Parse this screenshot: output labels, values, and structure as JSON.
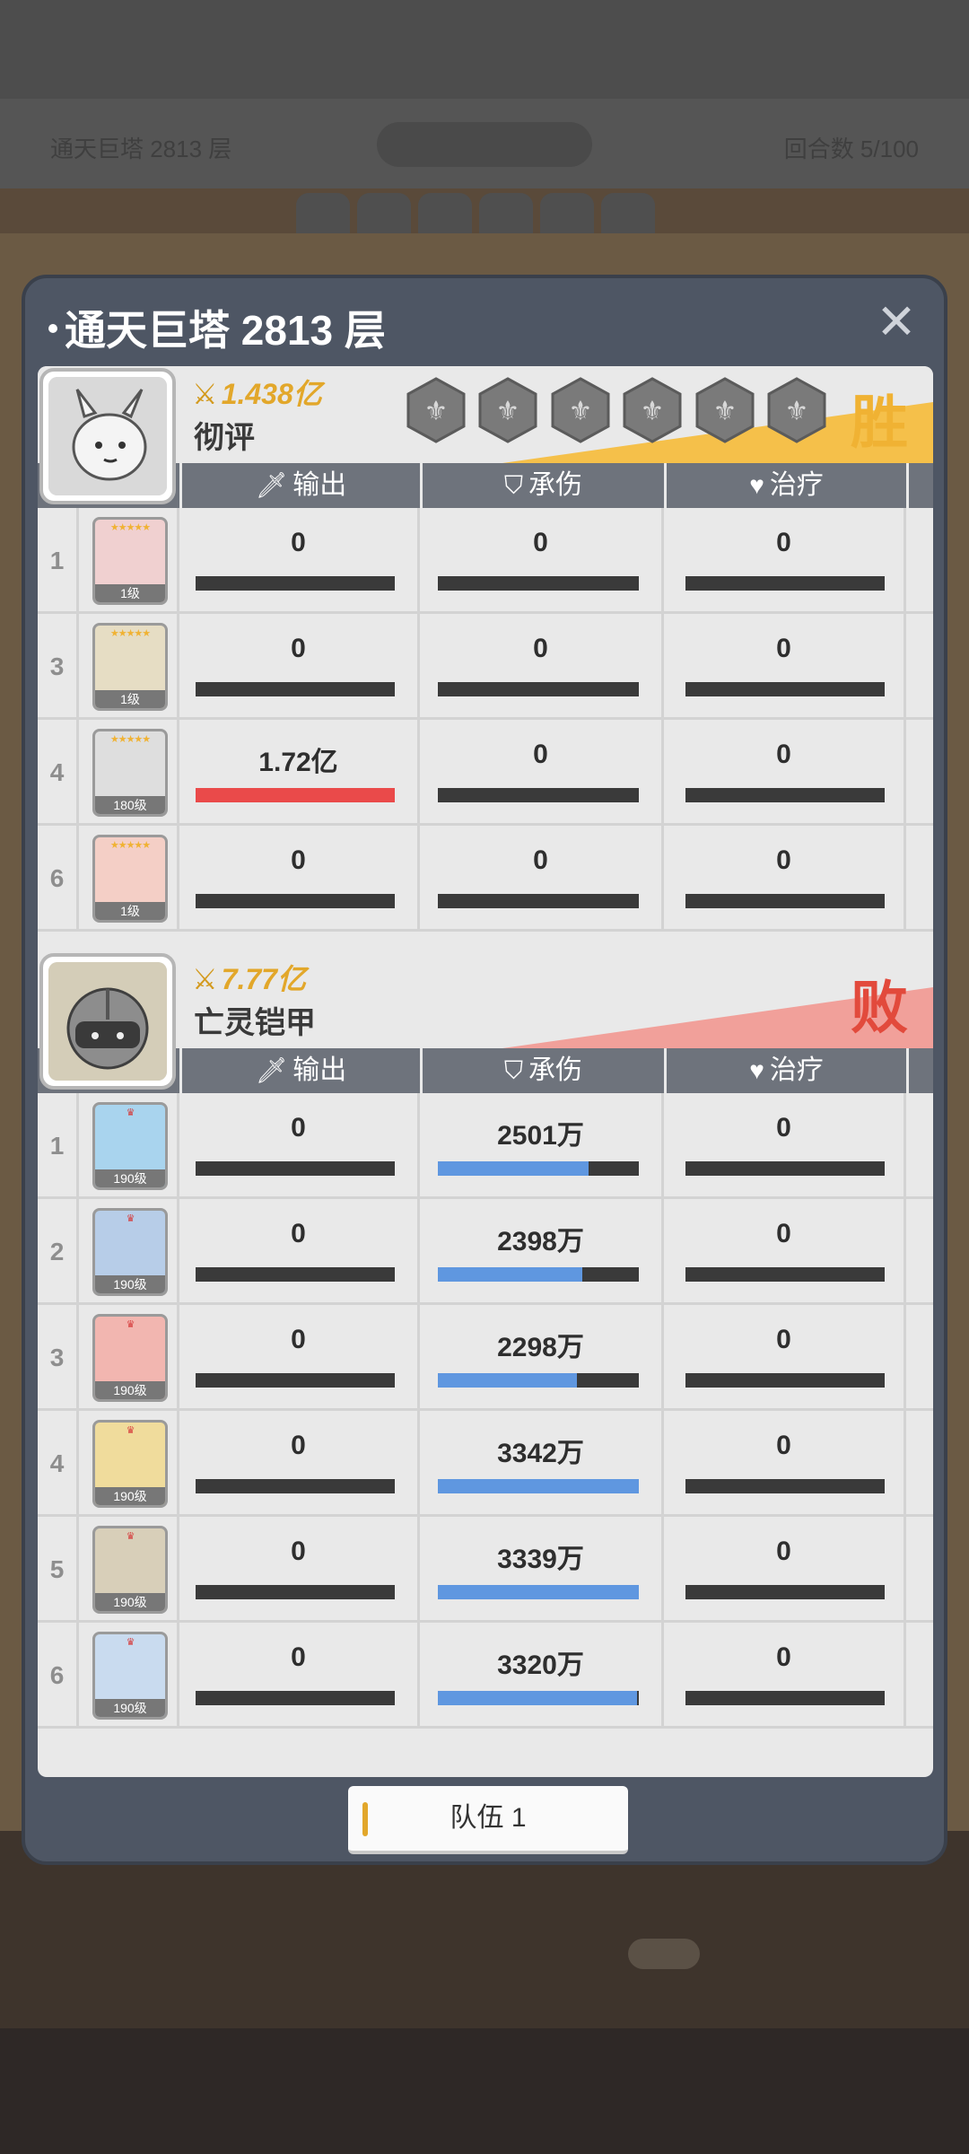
{
  "background": {
    "top_left": "通天巨塔 2813 层",
    "top_right": "回合数 5/100"
  },
  "modal": {
    "title": "通天巨塔 2813 层",
    "close_icon": "close-icon"
  },
  "columns": {
    "output": "输出",
    "tank": "承伤",
    "heal": "治疗"
  },
  "team_a": {
    "power": "1.438亿",
    "name": "彻评",
    "result": "胜",
    "result_color": "#f0b233",
    "hex_count": 6,
    "rows": [
      {
        "index": "1",
        "level": "1级",
        "output": "0",
        "output_ratio": 0,
        "tank": "0",
        "tank_ratio": 0,
        "heal": "0",
        "heal_ratio": 0
      },
      {
        "index": "3",
        "level": "1级",
        "output": "0",
        "output_ratio": 0,
        "tank": "0",
        "tank_ratio": 0,
        "heal": "0",
        "heal_ratio": 0
      },
      {
        "index": "4",
        "level": "180级",
        "output": "1.72亿",
        "output_ratio": 1,
        "tank": "0",
        "tank_ratio": 0,
        "heal": "0",
        "heal_ratio": 0
      },
      {
        "index": "6",
        "level": "1级",
        "output": "0",
        "output_ratio": 0,
        "tank": "0",
        "tank_ratio": 0,
        "heal": "0",
        "heal_ratio": 0
      }
    ]
  },
  "team_b": {
    "power": "7.77亿",
    "name": "亡灵铠甲",
    "result": "败",
    "result_color": "#e24a3c",
    "rows": [
      {
        "index": "1",
        "level": "190级",
        "output": "0",
        "output_ratio": 0,
        "tank": "2501万",
        "tank_ratio": 0.75,
        "heal": "0",
        "heal_ratio": 0
      },
      {
        "index": "2",
        "level": "190级",
        "output": "0",
        "output_ratio": 0,
        "tank": "2398万",
        "tank_ratio": 0.72,
        "heal": "0",
        "heal_ratio": 0
      },
      {
        "index": "3",
        "level": "190级",
        "output": "0",
        "output_ratio": 0,
        "tank": "2298万",
        "tank_ratio": 0.69,
        "heal": "0",
        "heal_ratio": 0
      },
      {
        "index": "4",
        "level": "190级",
        "output": "0",
        "output_ratio": 0,
        "tank": "3342万",
        "tank_ratio": 1,
        "heal": "0",
        "heal_ratio": 0
      },
      {
        "index": "5",
        "level": "190级",
        "output": "0",
        "output_ratio": 0,
        "tank": "3339万",
        "tank_ratio": 1,
        "heal": "0",
        "heal_ratio": 0
      },
      {
        "index": "6",
        "level": "190级",
        "output": "0",
        "output_ratio": 0,
        "tank": "3320万",
        "tank_ratio": 0.99,
        "heal": "0",
        "heal_ratio": 0
      }
    ]
  },
  "colors": {
    "output_fill": "#ea4a4a",
    "tank_fill": "#5f97e0",
    "bar_bg": "#3a3a3a",
    "gold": "#e2a72a"
  },
  "team_switch": {
    "label": "队伍 1"
  }
}
